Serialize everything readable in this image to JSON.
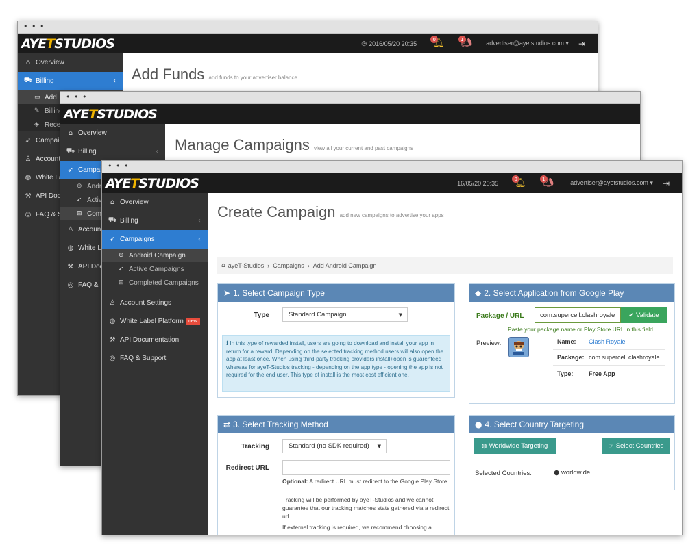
{
  "brand": {
    "logo_left": "AYE",
    "logo_y": "T",
    "logo_right": "STUDIOS"
  },
  "titlebar_dots": "• • •",
  "w1": {
    "timestamp": "2016/05/20 20:35",
    "badge1": "0",
    "badge2": "1",
    "user": "advertiser@ayetstudios.com",
    "sidebar": {
      "overview": "Overview",
      "billing": "Billing",
      "sub": [
        "Add",
        "Billing",
        "Rece"
      ],
      "campaigns": "Campaig",
      "account": "Account",
      "whitelabel": "White La",
      "api": "API Docu",
      "faq": "FAQ & S"
    },
    "page_title": "Add Funds",
    "page_subtitle": "add funds to your advertiser balance"
  },
  "w2": {
    "sidebar": {
      "overview": "Overview",
      "billing": "Billing",
      "campaigns": "Campaig",
      "sub": [
        "Andr",
        "Activ",
        "Com"
      ],
      "account": "Account",
      "whitelabel": "White L",
      "api": "API Doc",
      "faq": "FAQ & S"
    },
    "page_title": "Manage Campaigns",
    "page_subtitle": "view all your current and past campaigns"
  },
  "w3": {
    "timestamp": "16/05/20 20:35",
    "badge1": "0",
    "badge2": "1",
    "user": "advertiser@ayetstudios.com",
    "sidebar": {
      "overview": "Overview",
      "billing": "Billing",
      "campaigns": "Campaigns",
      "sub": [
        "Android Campaign",
        "Active Campaigns",
        "Completed Campaigns"
      ],
      "account": "Account Settings",
      "whitelabel": "White Label Platform",
      "new_badge": "new",
      "api": "API Documentation",
      "faq": "FAQ & Support"
    },
    "page_title": "Create Campaign",
    "page_subtitle": "add new campaigns to advertise your apps",
    "breadcrumb": [
      "ayeT-Studios",
      "Campaigns",
      "Add Android Campaign"
    ],
    "panel1": {
      "title": "1. Select Campaign Type",
      "type_label": "Type",
      "type_value": "Standard Campaign",
      "info": "In this type of rewarded install, users are going to download and install your app in return for a reward. Depending on the selected tracking method users will also open the app at least once. When using third-party tracking providers install+open is guarenteed whereas for ayeT-Studios tracking - depending on the app type - opening the app is not required for the end user. This type of install is the most cost efficient one."
    },
    "panel2": {
      "title": "2. Select Application from Google Play",
      "package_label": "Package / URL",
      "package_value": "com.supercell.clashroyale",
      "validate": "Validate",
      "hint": "Paste your package name or Play Store URL in this field",
      "preview_label": "Preview:",
      "name_label": "Name:",
      "name_value": "Clash Royale",
      "pkg_label": "Package:",
      "pkg_value": "com.supercell.clashroyale",
      "type_label": "Type:",
      "type_value": "Free App"
    },
    "panel3": {
      "title": "3. Select Tracking Method",
      "tracking_label": "Tracking",
      "tracking_value": "Standard (no SDK required)",
      "redirect_label": "Redirect URL",
      "optional_bold": "Optional:",
      "optional_text": "A redirect URL must redirect to the Google Play Store.",
      "p2": "Tracking will be performed by ayeT-Studios and we cannot guarantee that our tracking matches stats gathered via a redirect url.",
      "p3": "If external tracking is required, we recommend choosing a"
    },
    "panel4": {
      "title": "4. Select Country Targeting",
      "worldwide_btn": "Worldwide Targeting",
      "select_btn": "Select Countries",
      "selected_label": "Selected Countries:",
      "selected_value": "worldwide"
    }
  },
  "colors": {
    "accent": "#2e7dd1",
    "panel_header": "#5b87b5",
    "button": "#3a9a8c",
    "package_label": "#3a7a1a"
  }
}
